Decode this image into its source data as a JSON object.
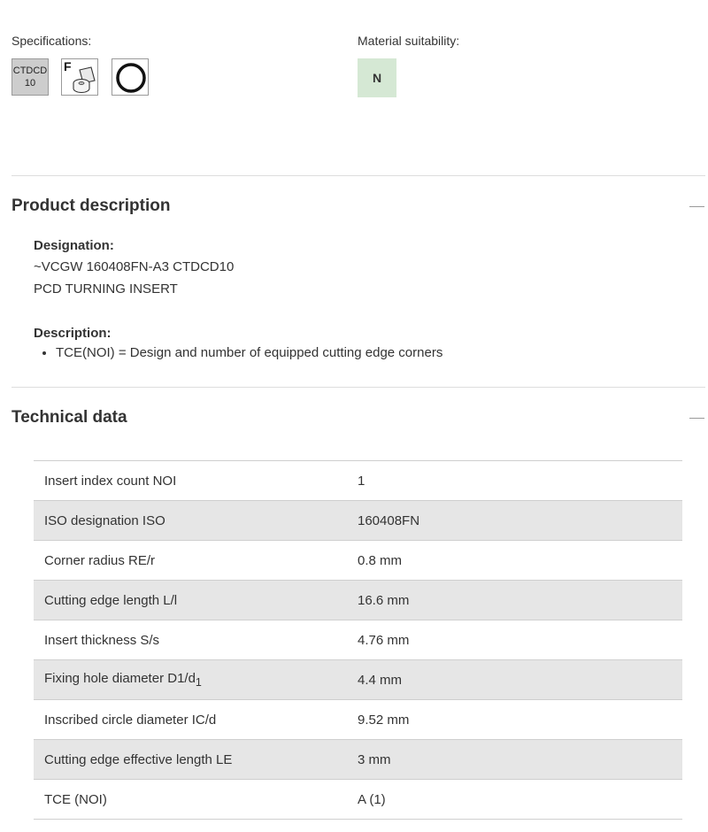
{
  "specifications": {
    "label": "Specifications:",
    "grade_line1": "CTDCD",
    "grade_line2": "10",
    "icons": [
      "grade-badge",
      "fine-finishing-icon",
      "insert-ring-icon"
    ],
    "fine_letter": "F"
  },
  "material": {
    "label": "Material suitability:",
    "code": "N",
    "color": "#d5e8d4"
  },
  "product_description": {
    "title": "Product description",
    "designation_label": "Designation:",
    "designation_line1": "~VCGW 160408FN-A3 CTDCD10",
    "designation_line2": "PCD TURNING INSERT",
    "description_label": "Description:",
    "description_items": [
      "TCE(NOI) = Design and number of equipped cutting edge corners"
    ]
  },
  "technical_data": {
    "title": "Technical data",
    "rows": [
      {
        "name": "Insert index count NOI",
        "value": "1"
      },
      {
        "name": "ISO designation ISO",
        "value": "160408FN"
      },
      {
        "name": "Corner radius RE/r",
        "value": "0.8 mm"
      },
      {
        "name": "Cutting edge length L/l",
        "value": "16.6 mm"
      },
      {
        "name": "Insert thickness S/s",
        "value": "4.76 mm"
      },
      {
        "name": "Fixing hole diameter D1/d",
        "sub": "1",
        "value": "4.4 mm"
      },
      {
        "name": "Inscribed circle diameter IC/d",
        "value": "9.52 mm"
      },
      {
        "name": "Cutting edge effective length LE",
        "value": "3 mm"
      },
      {
        "name": "TCE (NOI)",
        "value": "A (1)"
      }
    ]
  },
  "colors": {
    "text": "#333333",
    "stripe": "#e6e6e6",
    "grade_bg": "#cdcdcd"
  }
}
